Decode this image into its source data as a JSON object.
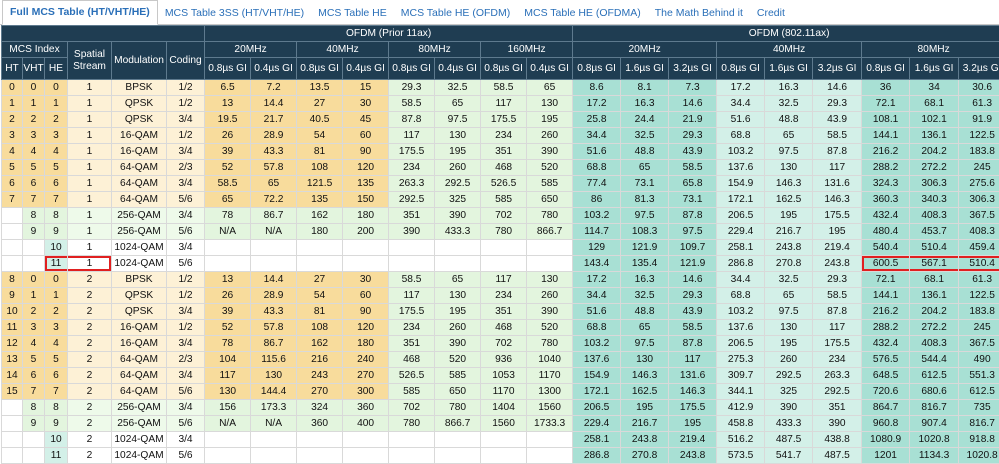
{
  "tabs": [
    {
      "label": "Full MCS Table (HT/VHT/HE)",
      "active": true
    },
    {
      "label": "MCS Table 3SS (HT/VHT/HE)",
      "active": false
    },
    {
      "label": "MCS Table HE",
      "active": false
    },
    {
      "label": "MCS Table HE (OFDM)",
      "active": false
    },
    {
      "label": "MCS Table HE (OFDMA)",
      "active": false
    },
    {
      "label": "The Math Behind it",
      "active": false
    },
    {
      "label": "Credit",
      "active": false
    }
  ],
  "header": {
    "ofdm_prior": "OFDM (Prior 11ax)",
    "ofdm_ax": "OFDM (802.11ax)",
    "mcs_index": "MCS Index",
    "spatial_stream": "Spatial Stream",
    "modulation": "Modulation",
    "coding": "Coding",
    "ht": "HT",
    "vht": "VHT",
    "he": "HE",
    "prior_bw": [
      "20MHz",
      "40MHz",
      "80MHz",
      "160MHz"
    ],
    "ax_bw": [
      "20MHz",
      "40MHz",
      "80MHz"
    ],
    "prior_gi": [
      "0.8µs GI",
      "0.4µs GI"
    ],
    "ax_gi": [
      "0.8µs GI",
      "1.6µs GI",
      "3.2µs GI"
    ]
  },
  "rows": [
    [
      "0",
      "0",
      "0",
      "1",
      "BPSK",
      "1/2",
      "6.5",
      "7.2",
      "13.5",
      "15",
      "29.3",
      "32.5",
      "58.5",
      "65",
      "8.6",
      "8.1",
      "7.3",
      "17.2",
      "16.3",
      "14.6",
      "36",
      "34",
      "30.6"
    ],
    [
      "1",
      "1",
      "1",
      "1",
      "QPSK",
      "1/2",
      "13",
      "14.4",
      "27",
      "30",
      "58.5",
      "65",
      "117",
      "130",
      "17.2",
      "16.3",
      "14.6",
      "34.4",
      "32.5",
      "29.3",
      "72.1",
      "68.1",
      "61.3"
    ],
    [
      "2",
      "2",
      "2",
      "1",
      "QPSK",
      "3/4",
      "19.5",
      "21.7",
      "40.5",
      "45",
      "87.8",
      "97.5",
      "175.5",
      "195",
      "25.8",
      "24.4",
      "21.9",
      "51.6",
      "48.8",
      "43.9",
      "108.1",
      "102.1",
      "91.9"
    ],
    [
      "3",
      "3",
      "3",
      "1",
      "16-QAM",
      "1/2",
      "26",
      "28.9",
      "54",
      "60",
      "117",
      "130",
      "234",
      "260",
      "34.4",
      "32.5",
      "29.3",
      "68.8",
      "65",
      "58.5",
      "144.1",
      "136.1",
      "122.5"
    ],
    [
      "4",
      "4",
      "4",
      "1",
      "16-QAM",
      "3/4",
      "39",
      "43.3",
      "81",
      "90",
      "175.5",
      "195",
      "351",
      "390",
      "51.6",
      "48.8",
      "43.9",
      "103.2",
      "97.5",
      "87.8",
      "216.2",
      "204.2",
      "183.8"
    ],
    [
      "5",
      "5",
      "5",
      "1",
      "64-QAM",
      "2/3",
      "52",
      "57.8",
      "108",
      "120",
      "234",
      "260",
      "468",
      "520",
      "68.8",
      "65",
      "58.5",
      "137.6",
      "130",
      "117",
      "288.2",
      "272.2",
      "245"
    ],
    [
      "6",
      "6",
      "6",
      "1",
      "64-QAM",
      "3/4",
      "58.5",
      "65",
      "121.5",
      "135",
      "263.3",
      "292.5",
      "526.5",
      "585",
      "77.4",
      "73.1",
      "65.8",
      "154.9",
      "146.3",
      "131.6",
      "324.3",
      "306.3",
      "275.6"
    ],
    [
      "7",
      "7",
      "7",
      "1",
      "64-QAM",
      "5/6",
      "65",
      "72.2",
      "135",
      "150",
      "292.5",
      "325",
      "585",
      "650",
      "86",
      "81.3",
      "73.1",
      "172.1",
      "162.5",
      "146.3",
      "360.3",
      "340.3",
      "306.3"
    ],
    [
      "",
      "8",
      "8",
      "1",
      "256-QAM",
      "3/4",
      "78",
      "86.7",
      "162",
      "180",
      "351",
      "390",
      "702",
      "780",
      "103.2",
      "97.5",
      "87.8",
      "206.5",
      "195",
      "175.5",
      "432.4",
      "408.3",
      "367.5"
    ],
    [
      "",
      "9",
      "9",
      "1",
      "256-QAM",
      "5/6",
      "N/A",
      "N/A",
      "180",
      "200",
      "390",
      "433.3",
      "780",
      "866.7",
      "114.7",
      "108.3",
      "97.5",
      "229.4",
      "216.7",
      "195",
      "480.4",
      "453.7",
      "408.3"
    ],
    [
      "",
      "",
      "10",
      "1",
      "1024-QAM",
      "3/4",
      "",
      "",
      "",
      "",
      "",
      "",
      "",
      "",
      "129",
      "121.9",
      "109.7",
      "258.1",
      "243.8",
      "219.4",
      "540.4",
      "510.4",
      "459.4"
    ],
    [
      "",
      "",
      "11",
      "1",
      "1024-QAM",
      "5/6",
      "",
      "",
      "",
      "",
      "",
      "",
      "",
      "",
      "143.4",
      "135.4",
      "121.9",
      "286.8",
      "270.8",
      "243.8",
      "600.5",
      "567.1",
      "510.4"
    ],
    [
      "8",
      "0",
      "0",
      "2",
      "BPSK",
      "1/2",
      "13",
      "14.4",
      "27",
      "30",
      "58.5",
      "65",
      "117",
      "130",
      "17.2",
      "16.3",
      "14.6",
      "34.4",
      "32.5",
      "29.3",
      "72.1",
      "68.1",
      "61.3"
    ],
    [
      "9",
      "1",
      "1",
      "2",
      "QPSK",
      "1/2",
      "26",
      "28.9",
      "54",
      "60",
      "117",
      "130",
      "234",
      "260",
      "34.4",
      "32.5",
      "29.3",
      "68.8",
      "65",
      "58.5",
      "144.1",
      "136.1",
      "122.5"
    ],
    [
      "10",
      "2",
      "2",
      "2",
      "QPSK",
      "3/4",
      "39",
      "43.3",
      "81",
      "90",
      "175.5",
      "195",
      "351",
      "390",
      "51.6",
      "48.8",
      "43.9",
      "103.2",
      "97.5",
      "87.8",
      "216.2",
      "204.2",
      "183.8"
    ],
    [
      "11",
      "3",
      "3",
      "2",
      "16-QAM",
      "1/2",
      "52",
      "57.8",
      "108",
      "120",
      "234",
      "260",
      "468",
      "520",
      "68.8",
      "65",
      "58.5",
      "137.6",
      "130",
      "117",
      "288.2",
      "272.2",
      "245"
    ],
    [
      "12",
      "4",
      "4",
      "2",
      "16-QAM",
      "3/4",
      "78",
      "86.7",
      "162",
      "180",
      "351",
      "390",
      "702",
      "780",
      "103.2",
      "97.5",
      "87.8",
      "206.5",
      "195",
      "175.5",
      "432.4",
      "408.3",
      "367.5"
    ],
    [
      "13",
      "5",
      "5",
      "2",
      "64-QAM",
      "2/3",
      "104",
      "115.6",
      "216",
      "240",
      "468",
      "520",
      "936",
      "1040",
      "137.6",
      "130",
      "117",
      "275.3",
      "260",
      "234",
      "576.5",
      "544.4",
      "490"
    ],
    [
      "14",
      "6",
      "6",
      "2",
      "64-QAM",
      "3/4",
      "117",
      "130",
      "243",
      "270",
      "526.5",
      "585",
      "1053",
      "1170",
      "154.9",
      "146.3",
      "131.6",
      "309.7",
      "292.5",
      "263.3",
      "648.5",
      "612.5",
      "551.3"
    ],
    [
      "15",
      "7",
      "7",
      "2",
      "64-QAM",
      "5/6",
      "130",
      "144.4",
      "270",
      "300",
      "585",
      "650",
      "1170",
      "1300",
      "172.1",
      "162.5",
      "146.3",
      "344.1",
      "325",
      "292.5",
      "720.6",
      "680.6",
      "612.5"
    ],
    [
      "",
      "8",
      "8",
      "2",
      "256-QAM",
      "3/4",
      "156",
      "173.3",
      "324",
      "360",
      "702",
      "780",
      "1404",
      "1560",
      "206.5",
      "195",
      "175.5",
      "412.9",
      "390",
      "351",
      "864.7",
      "816.7",
      "735"
    ],
    [
      "",
      "9",
      "9",
      "2",
      "256-QAM",
      "5/6",
      "N/A",
      "N/A",
      "360",
      "400",
      "780",
      "866.7",
      "1560",
      "1733.3",
      "229.4",
      "216.7",
      "195",
      "458.8",
      "433.3",
      "390",
      "960.8",
      "907.4",
      "816.7"
    ],
    [
      "",
      "",
      "10",
      "2",
      "1024-QAM",
      "3/4",
      "",
      "",
      "",
      "",
      "",
      "",
      "",
      "",
      "258.1",
      "243.8",
      "219.4",
      "516.2",
      "487.5",
      "438.8",
      "1080.9",
      "1020.8",
      "918.8"
    ],
    [
      "",
      "",
      "11",
      "2",
      "1024-QAM",
      "5/6",
      "",
      "",
      "",
      "",
      "",
      "",
      "",
      "",
      "286.8",
      "270.8",
      "243.8",
      "573.5",
      "541.7",
      "487.5",
      "1201",
      "1134.3",
      "1020.8"
    ]
  ]
}
